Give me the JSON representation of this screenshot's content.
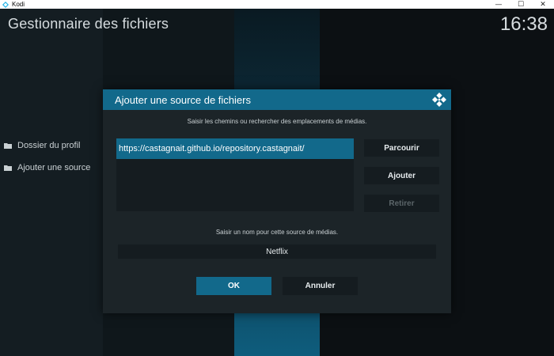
{
  "window": {
    "app_title": "Kodi",
    "controls": {
      "minimize": "—",
      "maximize": "☐",
      "close": "✕"
    }
  },
  "header": {
    "title": "Gestionnaire des fichiers",
    "clock": "16:38"
  },
  "sidebar": {
    "items": [
      {
        "label": "Dossier du profil",
        "icon": "folder-icon"
      },
      {
        "label": "Ajouter une source",
        "icon": "folder-icon"
      }
    ]
  },
  "dialog": {
    "title": "Ajouter une source de fichiers",
    "paths_hint": "Saisir les chemins ou rechercher des emplacements de médias.",
    "paths": [
      "https://castagnait.github.io/repository.castagnait/"
    ],
    "browse_label": "Parcourir",
    "add_label": "Ajouter",
    "remove_label": "Retirer",
    "name_hint": "Saisir un nom pour cette source de médias.",
    "name_value": "Netflix",
    "ok_label": "OK",
    "cancel_label": "Annuler"
  },
  "colors": {
    "accent": "#12698b",
    "dialog_bg": "#1c2428",
    "field_bg": "#151c20",
    "disabled_text": "#5b6569"
  }
}
